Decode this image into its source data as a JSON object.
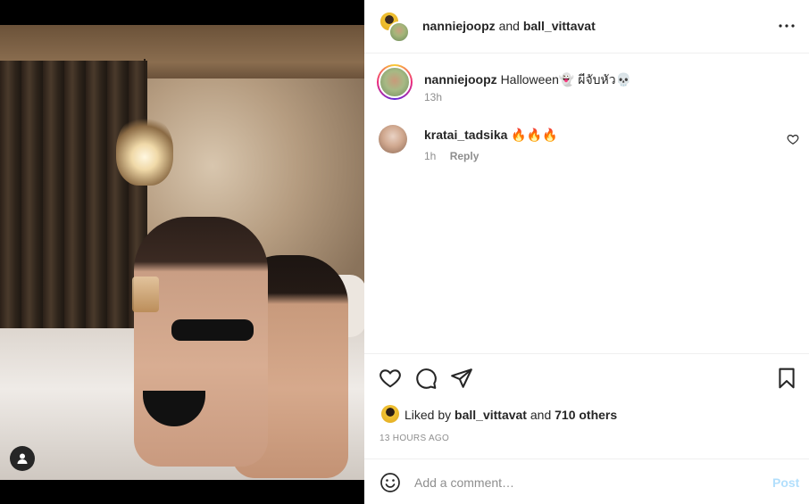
{
  "post": {
    "header": {
      "user1": "nanniejoopz",
      "conjunction": "and",
      "user2": "ball_vittavat",
      "more_icon": "more-horizontal-icon"
    },
    "caption": {
      "username": "nanniejoopz",
      "text": "Halloween👻 ผีจับหัว💀",
      "time": "13h"
    },
    "comments": [
      {
        "username": "kratai_tadsika",
        "text": "🔥🔥🔥",
        "time": "1h",
        "reply_label": "Reply"
      }
    ],
    "actions": {
      "like_icon": "heart-icon",
      "comment_icon": "comment-icon",
      "share_icon": "send-icon",
      "save_icon": "bookmark-icon"
    },
    "likes": {
      "prefix": "Liked by",
      "user": "ball_vittavat",
      "middle": "and",
      "others": "710 others"
    },
    "timestamp": "13 HOURS AGO",
    "add_comment": {
      "placeholder": "Add a comment…",
      "post_label": "Post",
      "emoji_icon": "emoji-icon"
    }
  },
  "media": {
    "tag_icon": "user-tag-icon"
  },
  "colors": {
    "text": "#262626",
    "secondary": "#8e8e8e",
    "post_disabled": "#b2dffc",
    "divider": "#efefef"
  }
}
